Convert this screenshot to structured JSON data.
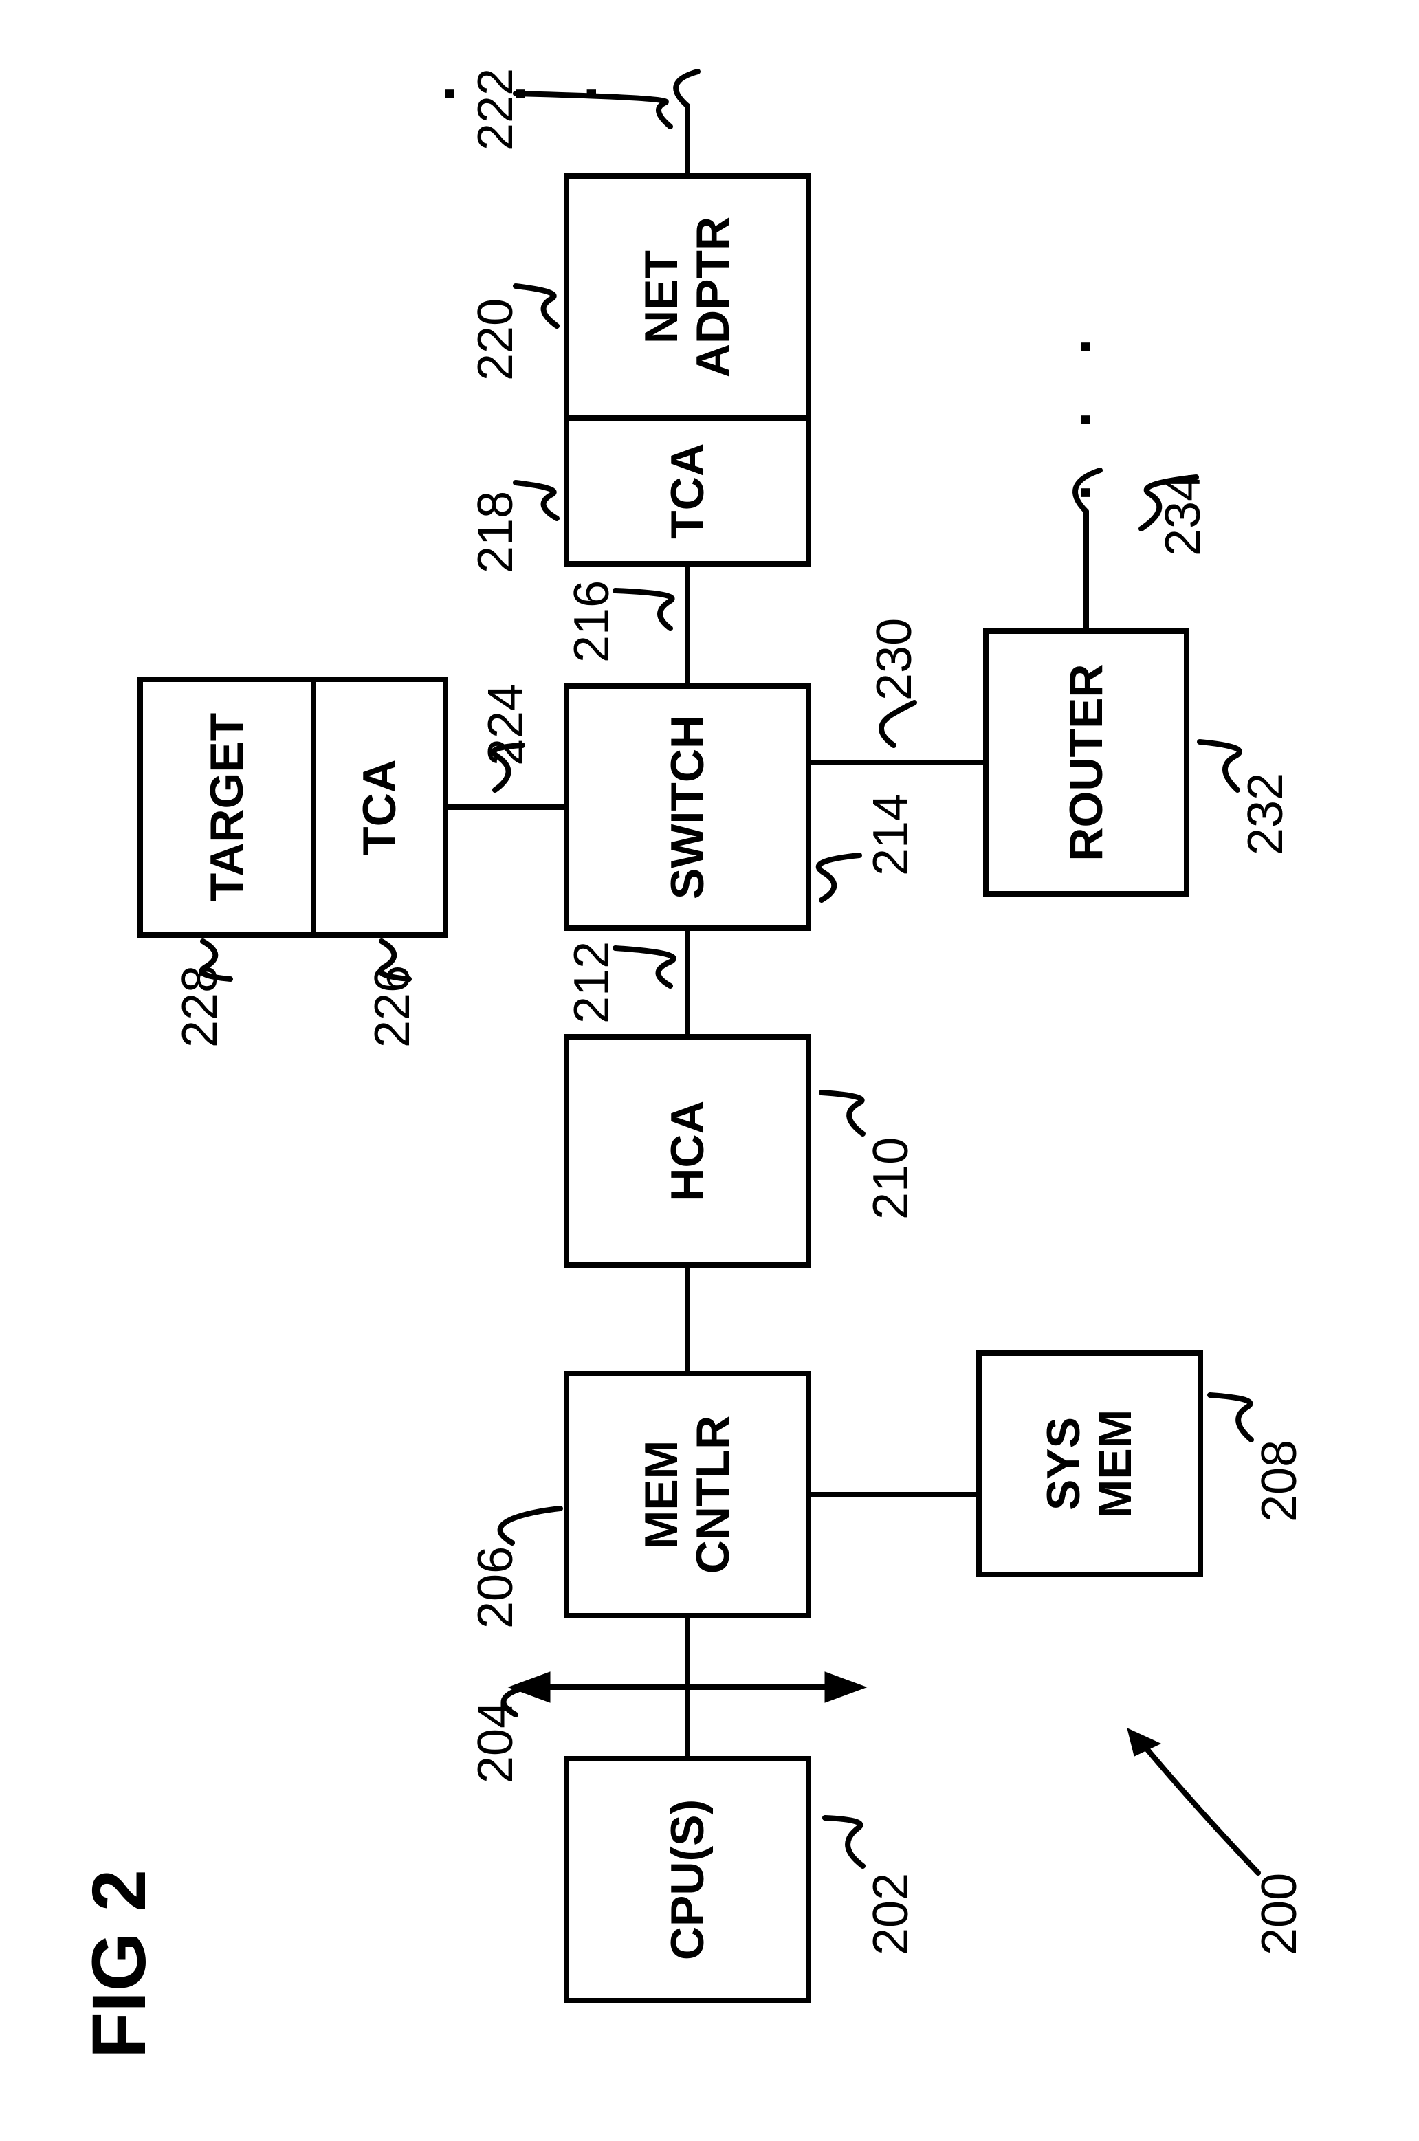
{
  "figure_label": "FIG 2",
  "blocks": {
    "cpu": {
      "label": "CPU(S)",
      "ref": "202"
    },
    "memctlr": {
      "label": "MEM\nCNTLR",
      "ref": "206"
    },
    "sysmem": {
      "label": "SYS\nMEM",
      "ref": "208"
    },
    "hca": {
      "label": "HCA",
      "ref": "210"
    },
    "switch": {
      "label": "SWITCH",
      "ref": "214"
    },
    "target": {
      "label": "TARGET",
      "ref": "228"
    },
    "tca_top": {
      "label": "TCA",
      "ref": "226"
    },
    "tca_right": {
      "label": "TCA",
      "ref": "218"
    },
    "netadptr": {
      "label": "NET\nADPTR",
      "ref": "220"
    },
    "router": {
      "label": "ROUTER",
      "ref": "232"
    }
  },
  "links": {
    "bus_204": "204",
    "hca_sw_212": "212",
    "sw_tca2_216": "216",
    "netadptr_out_222": "222",
    "tca1_sw_224": "224",
    "sw_router_230": "230",
    "router_out_234": "234"
  },
  "system_ref": "200",
  "ellipsis": ". . ."
}
